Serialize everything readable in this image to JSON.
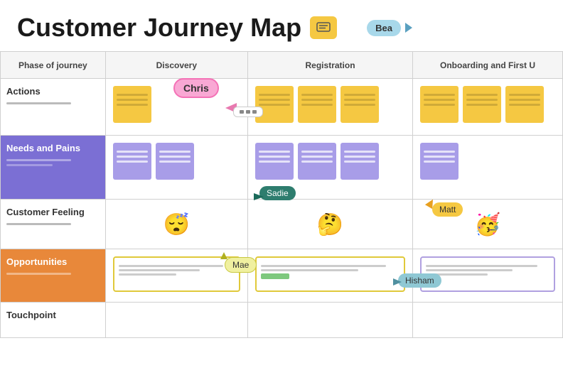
{
  "page": {
    "title": "Customer Journey Map",
    "chat_icon": "💬",
    "colors": {
      "yellow": "#f5c842",
      "purple": "#a89de8",
      "orange": "#e8883a",
      "needs_purple": "#7b6fd4",
      "teal": "#2e7d6e",
      "light_blue": "#a8d8ea"
    }
  },
  "header": {
    "title": "Customer Journey Map",
    "chat_button_label": "≡"
  },
  "cursors": {
    "bea": {
      "label": "Bea"
    },
    "chris": {
      "label": "Chris"
    },
    "sadie": {
      "label": "Sadie"
    },
    "matt": {
      "label": "Matt"
    },
    "mae": {
      "label": "Mae"
    },
    "hisham": {
      "label": "Hisham"
    }
  },
  "table": {
    "columns": [
      {
        "id": "phase",
        "label": "Phase of journey"
      },
      {
        "id": "discovery",
        "label": "Discovery"
      },
      {
        "id": "registration",
        "label": "Registration"
      },
      {
        "id": "onboarding",
        "label": "Onboarding and First U"
      }
    ],
    "rows": [
      {
        "id": "actions",
        "phase": "Actions",
        "phase_sub": ""
      },
      {
        "id": "needs",
        "phase": "Needs and Pains",
        "phase_sub": ""
      },
      {
        "id": "feeling",
        "phase": "Customer Feeling",
        "phase_sub": ""
      },
      {
        "id": "opportunities",
        "phase": "Opportunities",
        "phase_sub": ""
      },
      {
        "id": "touchpoint",
        "phase": "Touchpoint",
        "phase_sub": ""
      }
    ]
  }
}
